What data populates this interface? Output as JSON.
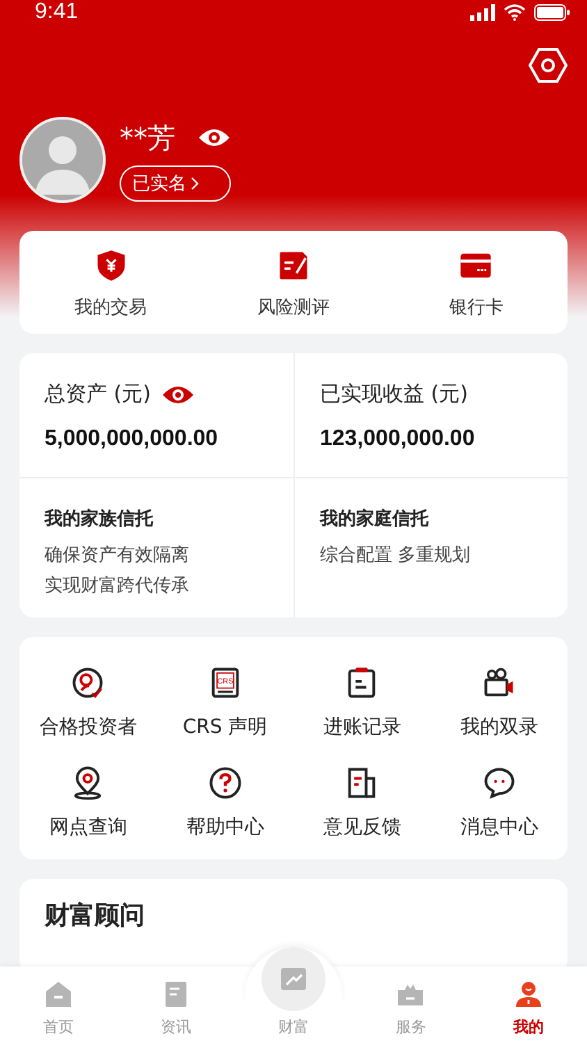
{
  "status_bar": {
    "time": "9:41"
  },
  "profile": {
    "name": "**芳",
    "verified_label": "已实名"
  },
  "shortcuts": [
    {
      "label": "我的交易"
    },
    {
      "label": "风险测评"
    },
    {
      "label": "银行卡"
    }
  ],
  "assets": {
    "total_label": "总资产 (元)",
    "total_value": "5,000,000,000.00",
    "realized_label": "已实现收益 (元)",
    "realized_value": "123,000,000.00"
  },
  "trusts": [
    {
      "title": "我的家族信托",
      "lines": [
        "确保资产有效隔离",
        "实现财富跨代传承"
      ]
    },
    {
      "title": "我的家庭信托",
      "lines": [
        "综合配置 多重规划"
      ]
    }
  ],
  "services": [
    {
      "label": "合格投资者"
    },
    {
      "label": "CRS 声明",
      "icon_text": "CRS"
    },
    {
      "label": "进账记录"
    },
    {
      "label": "我的双录"
    },
    {
      "label": "网点查询"
    },
    {
      "label": "帮助中心"
    },
    {
      "label": "意见反馈"
    },
    {
      "label": "消息中心"
    }
  ],
  "advisor": {
    "title": "财富顾问"
  },
  "tab_bar": [
    {
      "label": "首页",
      "selected": false
    },
    {
      "label": "资讯",
      "selected": false
    },
    {
      "label": "财富",
      "selected": false
    },
    {
      "label": "服务",
      "selected": false
    },
    {
      "label": "我的",
      "selected": true
    }
  ]
}
